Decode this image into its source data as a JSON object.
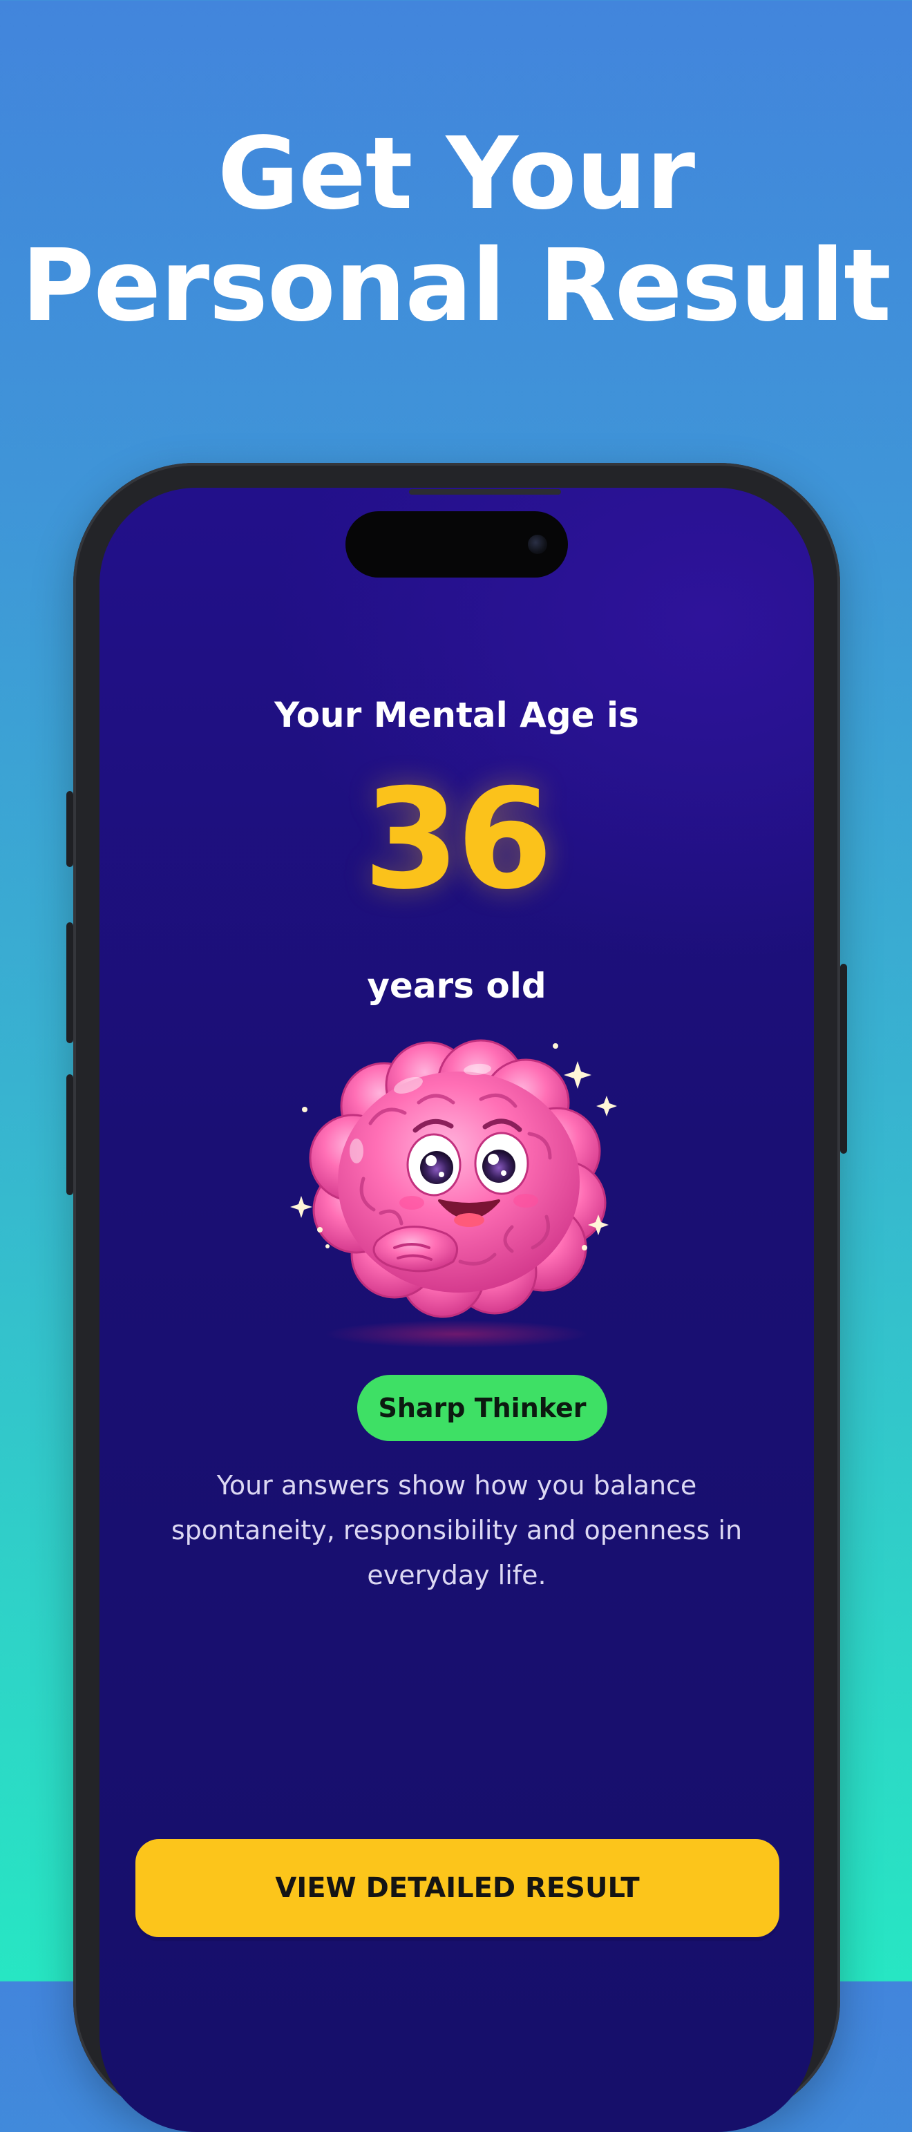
{
  "headline": {
    "line1": "Get Your",
    "line2": "Personal Result"
  },
  "result": {
    "label": "Your Mental Age is",
    "age": "36",
    "unit": "years old",
    "badge": "Sharp Thinker",
    "description": "Your answers show how you balance spontaneity, responsibility and openness in everyday life."
  },
  "cta": {
    "label": "VIEW DETAILED RESULT"
  },
  "colors": {
    "accent": "#fcc51b",
    "badge": "#3ee065",
    "screen_bg": "#1a0f74",
    "mascot": "#ff6fb5"
  },
  "illustration": {
    "icon": "brain-mascot-icon"
  }
}
